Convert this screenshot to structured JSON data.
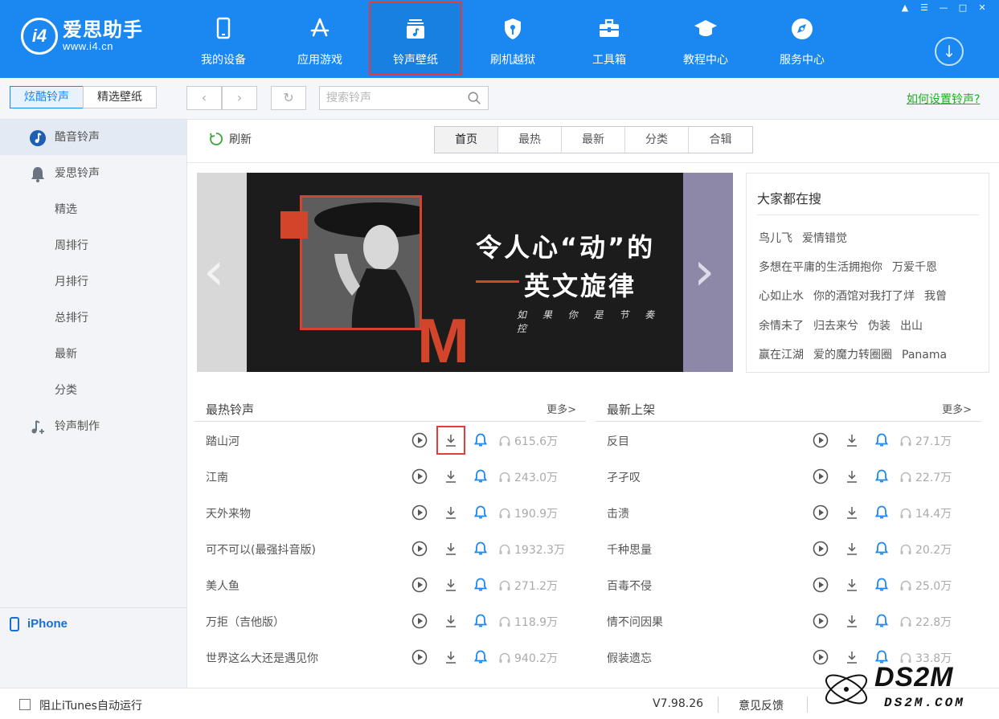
{
  "app": {
    "logo_text": "爱思助手",
    "logo_url": "www.i4.cn",
    "logo_mark": "i4"
  },
  "nav": [
    {
      "label": "我的设备",
      "icon": "phone-icon"
    },
    {
      "label": "应用游戏",
      "icon": "app-store-icon"
    },
    {
      "label": "铃声壁纸",
      "icon": "music-card-icon",
      "selected": true
    },
    {
      "label": "刷机越狱",
      "icon": "shield-key-icon"
    },
    {
      "label": "工具箱",
      "icon": "toolbox-icon"
    },
    {
      "label": "教程中心",
      "icon": "graduation-cap-icon"
    },
    {
      "label": "服务中心",
      "icon": "compass-icon"
    }
  ],
  "window_controls": [
    "shirt-icon",
    "menu-icon",
    "minimize-icon",
    "maximize-icon",
    "close-icon"
  ],
  "toolbar": {
    "seg_ringtone": "炫酷铃声",
    "seg_wallpaper": "精选壁纸",
    "search_placeholder": "搜索铃声",
    "help_link": "如何设置铃声?"
  },
  "sidebar": {
    "items": [
      {
        "label": "酷音铃声",
        "icon": "music-note-circle-icon",
        "active": true
      },
      {
        "label": "爱思铃声",
        "icon": "bell-icon"
      },
      {
        "label": "精选"
      },
      {
        "label": "周排行"
      },
      {
        "label": "月排行"
      },
      {
        "label": "总排行"
      },
      {
        "label": "最新"
      },
      {
        "label": "分类"
      },
      {
        "label": "铃声制作",
        "icon": "music-plus-icon"
      }
    ],
    "device": "iPhone"
  },
  "content": {
    "refresh": "刷新",
    "tabs": [
      "首页",
      "最热",
      "最新",
      "分类",
      "合辑"
    ],
    "active_tab": "首页",
    "banner": {
      "line1": "令人心“动”的",
      "line2": "英文旋律",
      "subtitle": "如 果 你 是 节 奏 控",
      "letter": "M"
    },
    "hot_search": {
      "title": "大家都在搜",
      "rows": [
        [
          "鸟儿飞",
          "爱情错觉"
        ],
        [
          "多想在平庸的生活拥抱你",
          "万爱千恩"
        ],
        [
          "心如止水",
          "你的酒馆对我打了烊",
          "我曾"
        ],
        [
          "余情未了",
          "归去来兮",
          "伪装",
          "出山"
        ],
        [
          "赢在江湖",
          "爱的魔力转圈圈",
          "Panama"
        ]
      ]
    },
    "hottest": {
      "title": "最热铃声",
      "more": "更多>",
      "rows": [
        {
          "name": "踏山河",
          "count": "615.6万"
        },
        {
          "name": "江南",
          "count": "243.0万"
        },
        {
          "name": "天外来物",
          "count": "190.9万"
        },
        {
          "name": "可不可以(最强抖音版)",
          "count": "1932.3万"
        },
        {
          "name": "美人鱼",
          "count": "271.2万"
        },
        {
          "name": "万拒（吉他版）",
          "count": "118.9万"
        },
        {
          "name": "世界这么大还是遇见你",
          "count": "940.2万"
        }
      ]
    },
    "newest": {
      "title": "最新上架",
      "more": "更多>",
      "rows": [
        {
          "name": "反目",
          "count": "27.1万"
        },
        {
          "name": "孑孑叹",
          "count": "22.7万"
        },
        {
          "name": "击溃",
          "count": "14.4万"
        },
        {
          "name": "千种思量",
          "count": "20.2万"
        },
        {
          "name": "百毒不侵",
          "count": "25.0万"
        },
        {
          "name": "情不问因果",
          "count": "22.8万"
        },
        {
          "name": "假装遗忘",
          "count": "33.8万"
        }
      ]
    }
  },
  "statusbar": {
    "itunes_label": "阻止iTunes自动运行",
    "version": "V7.98.26",
    "feedback": "意见反馈"
  },
  "watermark": {
    "text": "DS2M",
    "sub": "DS2M.COM"
  },
  "colors": {
    "brand": "#1a88f0",
    "highlight": "#e63b3b",
    "link_green": "#1bb01b",
    "bell_blue": "#1a88f0"
  }
}
